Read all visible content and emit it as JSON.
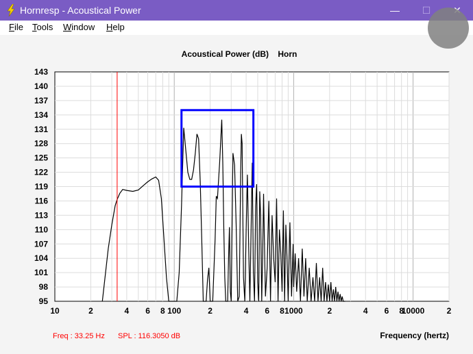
{
  "window": {
    "title": "Hornresp - Acoustical Power",
    "minimize_glyph": "—",
    "maximize_glyph": "☐",
    "close_glyph": "✕"
  },
  "menu": {
    "items": [
      {
        "label": "File",
        "accel": "F",
        "rest": "ile"
      },
      {
        "label": "Tools",
        "accel": "T",
        "rest": "ools"
      },
      {
        "label": "Window",
        "accel": "W",
        "rest": "indow"
      },
      {
        "label": "Help",
        "accel": "H",
        "rest": "elp"
      }
    ]
  },
  "chart_data": {
    "type": "line",
    "title": "Acoustical Power (dB)    Horn",
    "xlabel": "Frequency (hertz)",
    "ylabel": "",
    "xscale": "log",
    "xlim": [
      10,
      20000
    ],
    "ylim": [
      95,
      143
    ],
    "yticks": [
      "143",
      "140",
      "137",
      "134",
      "131",
      "128",
      "125",
      "122",
      "119",
      "116",
      "113",
      "110",
      "107",
      "104",
      "101",
      "98",
      "95"
    ],
    "xticks": [
      {
        "value": 10,
        "label": "10"
      },
      {
        "value": 20,
        "label": "2"
      },
      {
        "value": 40,
        "label": "4"
      },
      {
        "value": 60,
        "label": "6"
      },
      {
        "value": 80,
        "label": "8"
      },
      {
        "value": 100,
        "label": "100"
      },
      {
        "value": 200,
        "label": "2"
      },
      {
        "value": 400,
        "label": "4"
      },
      {
        "value": 600,
        "label": "6"
      },
      {
        "value": 800,
        "label": "8"
      },
      {
        "value": 1000,
        "label": "1000"
      },
      {
        "value": 2000,
        "label": "2"
      },
      {
        "value": 4000,
        "label": "4"
      },
      {
        "value": 6000,
        "label": "6"
      },
      {
        "value": 8000,
        "label": "8"
      },
      {
        "value": 10000,
        "label": "10000"
      },
      {
        "value": 20000,
        "label": "2"
      }
    ],
    "grid": true,
    "cursor": {
      "freq": 33.25,
      "color": "#ff0000"
    },
    "readout": {
      "freq_text": "Freq : 33.25 Hz",
      "spl_text": "SPL : 116.3050 dB",
      "color": "#ff0000"
    },
    "highlight_box": {
      "x_from": 115,
      "x_to": 460,
      "y_from": 119,
      "y_to": 135,
      "color": "#0000ff"
    },
    "series": [
      {
        "color": "#000000",
        "x": [
          25,
          28,
          30,
          32,
          33.25,
          35,
          37,
          40,
          45,
          50,
          55,
          60,
          65,
          70,
          74,
          78,
          82,
          86,
          90,
          95,
          100,
          105,
          110,
          115,
          120,
          125,
          130,
          135,
          140,
          145,
          150,
          155,
          160,
          165,
          170,
          175,
          180,
          185,
          190,
          195,
          200,
          210,
          220,
          225,
          230,
          240,
          250,
          255,
          260,
          265,
          270,
          275,
          280,
          285,
          290,
          295,
          300,
          310,
          320,
          330,
          340,
          350,
          360,
          365,
          370,
          380,
          390,
          400,
          410,
          420,
          430,
          440,
          450,
          460,
          470,
          480,
          490,
          500,
          510,
          520,
          530,
          540,
          550,
          560,
          580,
          600,
          620,
          640,
          660,
          680,
          700,
          720,
          740,
          760,
          780,
          800,
          820,
          840,
          860,
          880,
          900,
          930,
          960,
          990,
          1000,
          1030,
          1060,
          1100,
          1140,
          1180,
          1220,
          1260,
          1300,
          1350,
          1400,
          1450,
          1500,
          1550,
          1600,
          1650,
          1700,
          1750,
          1800,
          1850,
          1900,
          1950,
          2000,
          2050,
          2100,
          2150,
          2200,
          2250,
          2300,
          2350,
          2400,
          2450,
          2500,
          2550,
          2600,
          2650,
          2700
        ],
        "y": [
          95,
          106,
          111,
          115,
          116.3,
          117.6,
          118.4,
          118.2,
          118.0,
          118.3,
          119.2,
          120.0,
          120.6,
          121.0,
          120.3,
          116.5,
          108.0,
          100.0,
          95.0,
          95.0,
          95.0,
          95.0,
          101.0,
          115.0,
          131.3,
          126.5,
          122.0,
          120.5,
          120.5,
          122.5,
          126.0,
          130.0,
          129.0,
          120.0,
          108.0,
          95.0,
          95.0,
          95.0,
          99.5,
          102.0,
          95.0,
          95.0,
          108.0,
          117.0,
          116.5,
          124.0,
          133.0,
          124.0,
          110.0,
          100.0,
          95.0,
          95.0,
          95.0,
          104.0,
          110.5,
          97.0,
          95.0,
          126.0,
          123.5,
          111.0,
          95.0,
          96.0,
          122.0,
          130.0,
          128.0,
          100.0,
          95.0,
          110.0,
          121.5,
          106.0,
          95.0,
          110.0,
          124.0,
          101.0,
          95.0,
          115.0,
          119.5,
          99.0,
          95.0,
          118.0,
          112.5,
          95.0,
          105.0,
          117.5,
          96.0,
          102.0,
          116.0,
          95.0,
          113.0,
          104.0,
          99.0,
          116.5,
          95.0,
          110.0,
          105.0,
          97.0,
          114.0,
          95.0,
          111.0,
          104.0,
          95.0,
          111.5,
          96.0,
          107.0,
          98.0,
          105.0,
          97.0,
          104.0,
          95.0,
          106.0,
          96.0,
          104.0,
          95.0,
          102.0,
          95.0,
          100.0,
          95.0,
          103.0,
          95.0,
          100.0,
          95.0,
          102.0,
          95.0,
          99.0,
          95.0,
          98.5,
          95.0,
          99.0,
          95.0,
          97.5,
          95.0,
          98.0,
          95.0,
          97.0,
          95.0,
          96.5,
          95.0,
          96.0,
          95.0,
          95.0,
          95.0
        ]
      }
    ]
  }
}
